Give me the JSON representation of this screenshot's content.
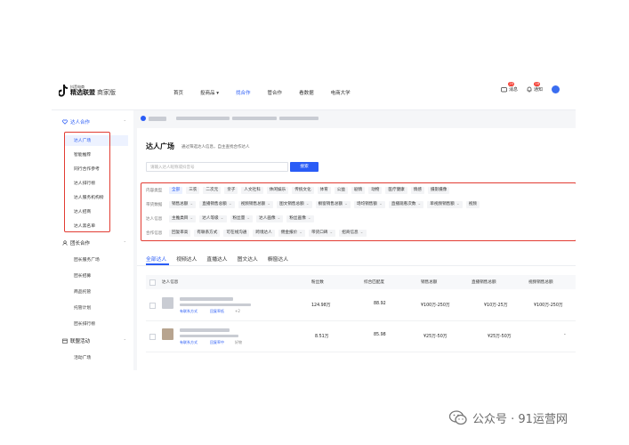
{
  "app": {
    "logo_top": "抖音电商",
    "logo_title": "精选联盟",
    "logo_suffix": "商家版"
  },
  "topnav": [
    {
      "label": "首页",
      "active": false
    },
    {
      "label": "投商品 ▾",
      "active": false
    },
    {
      "label": "找合作",
      "active": true
    },
    {
      "label": "管合作",
      "active": false
    },
    {
      "label": "看数据",
      "active": false
    },
    {
      "label": "电商大学",
      "active": false
    }
  ],
  "topright": {
    "message_label": "消息",
    "message_badge": "20",
    "notice_label": "通知",
    "notice_badge": "18"
  },
  "sidebar": {
    "group1": "达人合作",
    "group1_items": [
      "达人广场",
      "智能推荐",
      "同行合作参考",
      "达人排行榜",
      "达人服务机构榜",
      "达人招商",
      "达人黑名单"
    ],
    "group2": "团长合作",
    "group2_items": [
      "团长服务广场",
      "团长招募",
      "商品托管",
      "托管计划",
      "团长排行榜"
    ],
    "group3": "联盟活动",
    "group3_items": [
      "活动广场"
    ]
  },
  "page": {
    "title": "达人广场",
    "subtitle": "通过筛选达人信息，自主查找合作达人",
    "search_placeholder": "请输入达人昵称或抖音号",
    "search_button": "搜索"
  },
  "filters": [
    {
      "label": "内容类型",
      "chips": [
        "全部",
        "三农",
        "二次元",
        "亲子",
        "人文社科",
        "休闲娱乐",
        "传统文化",
        "体育",
        "公益",
        "剧情",
        "动物",
        "医疗健康",
        "情感",
        "摄影摄像",
        "教育校园"
      ]
    },
    {
      "label": "带货数据",
      "chips": [
        "销售总额",
        "直播销售总额",
        "视频销售总额",
        "图文销售总额",
        "橱窗销售总额",
        "场均销售额",
        "直播观看次数",
        "单视频销售额",
        "视频"
      ]
    },
    {
      "label": "达人信息",
      "chips": [
        "主推类目",
        "达人等级",
        "粉丝量",
        "达人画像",
        "粉丝画像"
      ]
    },
    {
      "label": "合作信息",
      "chips": [
        "回复率高",
        "有联系方式",
        "可在线沟通",
        "跨境达人",
        "佣金报价",
        "带货口碑",
        "招商信息"
      ]
    }
  ],
  "tabs": [
    "全部达人",
    "视频达人",
    "直播达人",
    "图文达人",
    "橱窗达人"
  ],
  "table": {
    "headers": [
      "达人信息",
      "粉丝数",
      "综合匹配度",
      "销售总额",
      "直播销售总额",
      "视频销售总额"
    ],
    "rows": [
      {
        "tags": [
          "有联系方式",
          "回复率低",
          "+2"
        ],
        "fans": "124.98万",
        "match": "88.92",
        "sales": "¥100万-250万",
        "live": "¥10万-25万",
        "video": "¥100万-250万"
      },
      {
        "tags": [
          "有联系方式",
          "回复率中",
          "好物"
        ],
        "fans": "8.51万",
        "match": "85.98",
        "sales": "¥25万-50万",
        "live": "¥25万-50万",
        "video": "-"
      }
    ]
  },
  "watermark": "公众号 · 91运营网",
  "colors": {
    "accent": "#2a5cf6",
    "highlight": "#e23c33"
  }
}
